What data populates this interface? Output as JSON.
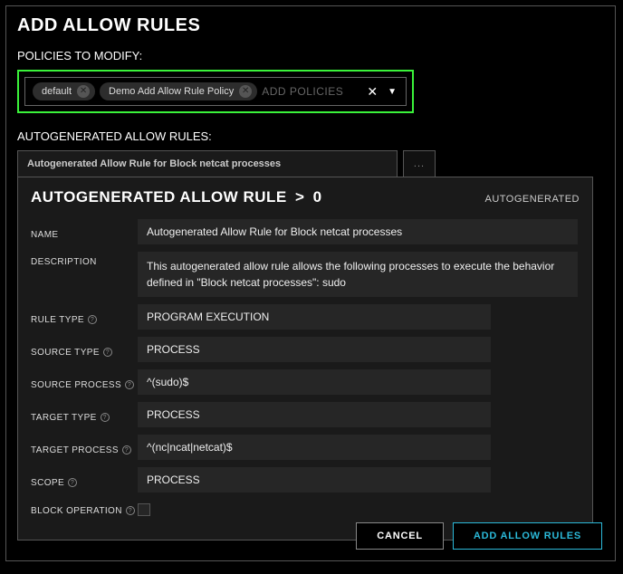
{
  "title": "ADD ALLOW RULES",
  "policies": {
    "label": "POLICIES TO MODIFY:",
    "chips": [
      {
        "label": "default"
      },
      {
        "label": "Demo Add Allow Rule Policy"
      }
    ],
    "placeholder": "ADD POLICIES",
    "clear_glyph": "✕",
    "dropdown_glyph": "▼"
  },
  "autogen": {
    "label": "AUTOGENERATED ALLOW RULES:",
    "tab": "Autogenerated Allow Rule for Block netcat processes",
    "more": "..."
  },
  "rule": {
    "title_prefix": "AUTOGENERATED ALLOW RULE",
    "title_index": "0",
    "badge": "AUTOGENERATED",
    "fields": {
      "name_label": "NAME",
      "name_value": "Autogenerated Allow Rule for Block netcat processes",
      "desc_label": "DESCRIPTION",
      "desc_value": "This autogenerated allow rule allows the following processes to execute the behavior defined in \"Block netcat processes\": sudo",
      "ruletype_label": "RULE TYPE",
      "ruletype_value": "PROGRAM EXECUTION",
      "sourcetype_label": "SOURCE TYPE",
      "sourcetype_value": "PROCESS",
      "sourceproc_label": "SOURCE PROCESS",
      "sourceproc_value": "^(sudo)$",
      "targettype_label": "TARGET TYPE",
      "targettype_value": "PROCESS",
      "targetproc_label": "TARGET PROCESS",
      "targetproc_value": "^(nc|ncat|netcat)$",
      "scope_label": "SCOPE",
      "scope_value": "PROCESS",
      "blockop_label": "BLOCK OPERATION"
    }
  },
  "footer": {
    "cancel": "CANCEL",
    "submit": "ADD ALLOW RULES"
  },
  "help_glyph": "?"
}
